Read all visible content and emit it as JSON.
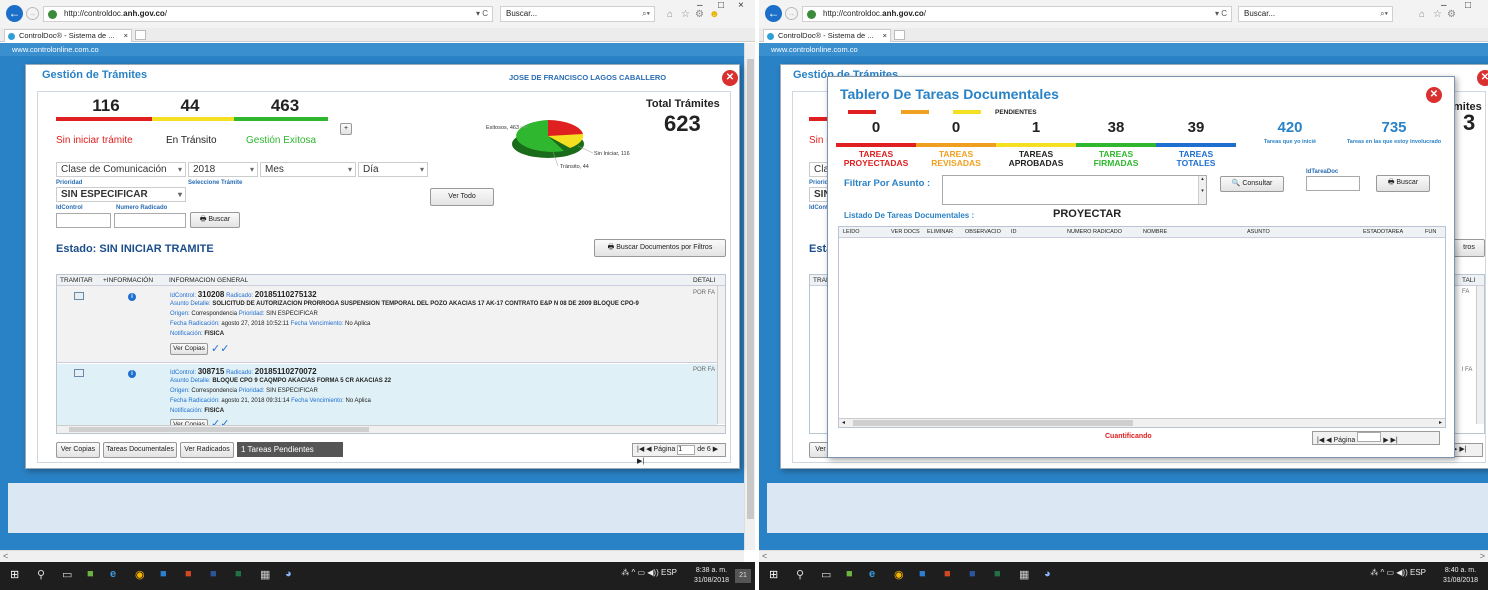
{
  "browser": {
    "url_prefix": "http://controldoc.",
    "url_domain": "anh.gov.co",
    "url_suffix": "/",
    "url_controls": "▾ C",
    "search_placeholder": "Buscar...",
    "search_icon": "⌕▾",
    "tab_title": "ControlDoc® - Sistema de ...",
    "tab_close": "×",
    "back_icon": "arrow-left-icon",
    "icons": [
      "home-icon",
      "star-icon",
      "gear-icon",
      "smiley-icon"
    ],
    "win_min": "–",
    "win_max": "□",
    "win_close": "×"
  },
  "site": {
    "banner": "www.controlonline.com.co"
  },
  "left": {
    "title": "Gestión de Trámites",
    "user": "JOSE DE FRANCISCO LAGOS CABALLERO",
    "close": "✕",
    "counts": {
      "sin": "116",
      "transito": "44",
      "exitosa": "463"
    },
    "labels": {
      "sin": "Sin iniciar trámite",
      "transito": "En Tránsito",
      "exitosa": "Gestión Exitosa"
    },
    "plus": "+",
    "total_label": "Total Trámites",
    "total": "623",
    "pie": {
      "exitosos": "Exitosos, 463",
      "sin": "Sin Iniciar, 116",
      "transito": "Tránsito, 44"
    },
    "filters": {
      "clase": "Clase de Comunicación",
      "anio": "2018",
      "mes": "Mes",
      "dia": "Día",
      "prioridad_lbl": "Prioridad",
      "prioridad": "SIN ESPECIFICAR",
      "tramite_lbl": "Seleccione Trámite",
      "idcontrol_lbl": "IdControl",
      "radicado_lbl": "Numero Radicado",
      "buscar": "Buscar",
      "ver_todo": "Ver Todo"
    },
    "estado_lbl": "Estado:",
    "estado": "SIN INICIAR TRAMITE",
    "buscar_filtros": "Buscar Documentos por Filtros",
    "grid_headers": [
      "TRAMITAR",
      "+INFORMACIÓN",
      "INFORMACION GENERAL",
      "DETALI"
    ],
    "rows": [
      {
        "idcontrol_lbl": "IdControl:",
        "idcontrol": "310208",
        "radicado_lbl": "Radicado:",
        "radicado": "20185110275132",
        "asunto_lbl": "Asunto Detalle:",
        "asunto": "SOLICITUD DE AUTORIZACION PRORROGA SUSPENSION TEMPORAL DEL POZO AKACIAS 17 AK-17 CONTRATO E&P N 08 DE 2009 BLOQUE CPO-9",
        "origen_lbl": "Origen:",
        "origen": "Correspondencia",
        "prioridad_lbl": "Prioridad:",
        "prioridad": "SIN ESPECIFICAR",
        "fecha_lbl": "Fecha Radicación:",
        "fecha": "agosto 27, 2018 10:52:11",
        "venc_lbl": "Fecha Vencimiento:",
        "venc": "No Aplica",
        "notif_lbl": "Notificación:",
        "notif": "FISICA",
        "copias": "Ver Copias",
        "detalle": "POR FA"
      },
      {
        "idcontrol_lbl": "IdControl:",
        "idcontrol": "308715",
        "radicado_lbl": "Radicado:",
        "radicado": "20185110270072",
        "asunto_lbl": "Asunto Detalle:",
        "asunto": "BLOQUE CPO 9 CAQMPO AKACIAS FORMA 5 CR  AKACIAS 22",
        "origen_lbl": "Origen:",
        "origen": "Correspondencia",
        "prioridad_lbl": "Prioridad:",
        "prioridad": "SIN ESPECIFICAR",
        "fecha_lbl": "Fecha Radicación:",
        "fecha": "agosto 21, 2018 09:31:14",
        "venc_lbl": "Fecha Vencimiento:",
        "venc": "No Aplica",
        "notif_lbl": "Notificación:",
        "notif": "FISICA",
        "copias": "Ver Copias",
        "detalle": "POR FA"
      }
    ],
    "bottom": {
      "ver_copias": "Ver Copias",
      "tareas": "Tareas Documentales",
      "radicados": "Ver Radicados",
      "pendientes": "1 Tareas Pendientes"
    },
    "pager": {
      "first": "|◀",
      "prev": "◀",
      "pagina": "Página",
      "page": "1",
      "de": "de 6",
      "next": "▶",
      "last": "▶|"
    }
  },
  "right": {
    "bg_title": "Gestión de Trámites",
    "bg_total": "mites",
    "bg_total_n": "3",
    "bg_sin": "Sin i",
    "bg_clas": "Clas",
    "bg_prior": "Priorid",
    "bg_sin2": "SIN",
    "bg_idc": "IdCont",
    "bg_esta": "Esta",
    "bg_tram": "TRAM",
    "bg_detali": "TALI",
    "bg_fa": "FA",
    "bg_fa2": "l FA",
    "bg_trosbtn": "tros",
    "bg_verc": "Ver C",
    "modal_title": "Tablero De Tareas Documentales",
    "close": "✕",
    "pendientes": "PENDIENTES",
    "counts": [
      "0",
      "0",
      "1",
      "38",
      "39"
    ],
    "tareas_word": "TAREAS",
    "states": [
      "PROYECTADAS",
      "REVISADAS",
      "APROBADAS",
      "FIRMADAS",
      "TOTALES"
    ],
    "yo_inicie": "420",
    "yo_inicie_lbl": "Tareas que yo inicié",
    "involucrado": "735",
    "involucrado_lbl": "Tareas en las que estoy involucrado",
    "filtrar_lbl": "Filtrar Por Asunto :",
    "consultar": "Consultar",
    "idtarea_lbl": "IdTareaDoc",
    "buscar": "Buscar",
    "listado_lbl": "Listado De Tareas Documentales :",
    "listado_estado": "PROYECTAR",
    "grid_headers": [
      "LEIDO",
      "VER DOCS",
      "ELIMINAR",
      "OBSERVACIO",
      "ID",
      "NUMERO RADICADO",
      "NOMBRE",
      "ASUNTO",
      "ESTADOTAREA",
      "FUN"
    ],
    "cuantificando": "Cuantificando",
    "pager": {
      "first": "|◀",
      "prev": "◀",
      "pagina": "Página",
      "next": "▶",
      "last": "▶|"
    }
  },
  "taskbar": {
    "items": [
      "windows-icon",
      "search-icon",
      "task-view-icon",
      "store-icon",
      "ie-icon",
      "chrome-icon",
      "outlook-icon",
      "powerpoint-icon",
      "word-icon",
      "excel-icon",
      "calculator-icon",
      "paint-icon"
    ],
    "tray": "⁂  ^  ▭  ◀))  ESP",
    "left_time": "8:38 a. m.",
    "right_time": "8:40 a. m.",
    "date": "31/08/2018",
    "notif_badge": "21"
  },
  "colors": {
    "red": "#e02020",
    "orange": "#f0a020",
    "yellow": "#f4e020",
    "green": "#2fb72f",
    "blue": "#1f6fd0",
    "accent": "#2a82c6"
  }
}
